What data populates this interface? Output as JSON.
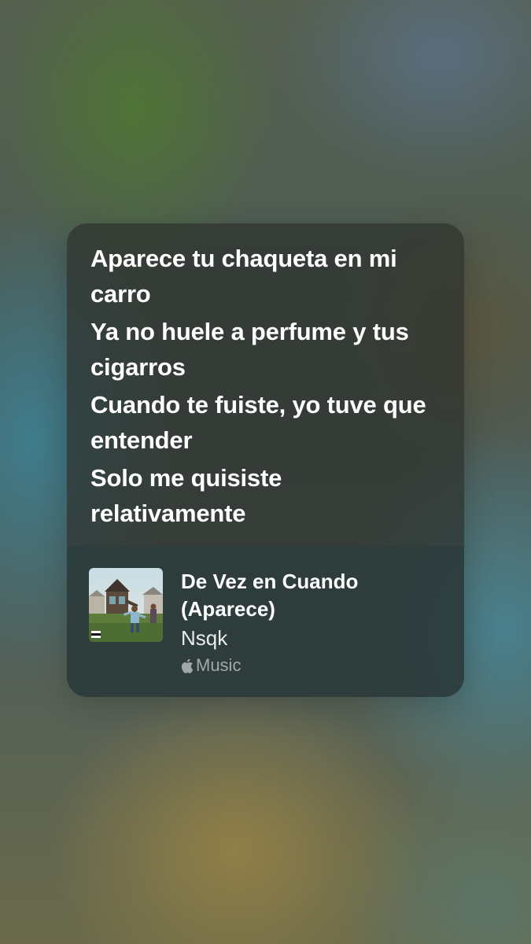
{
  "lyrics": {
    "lines": [
      "Aparece tu chaqueta en mi carro",
      "Ya no huele a perfume y tus cigarros",
      "Cuando te fuiste, yo tuve que entender",
      "Solo me quisiste relativamente"
    ]
  },
  "track": {
    "title": "De Vez en Cuando (Aparece)",
    "artist": "Nsqk",
    "service_label": "Music",
    "service_icon": "apple-icon",
    "artwork_icon": "album-artwork"
  },
  "colors": {
    "lyric_text": "#ffffff",
    "service_text": "#9aa09c"
  }
}
